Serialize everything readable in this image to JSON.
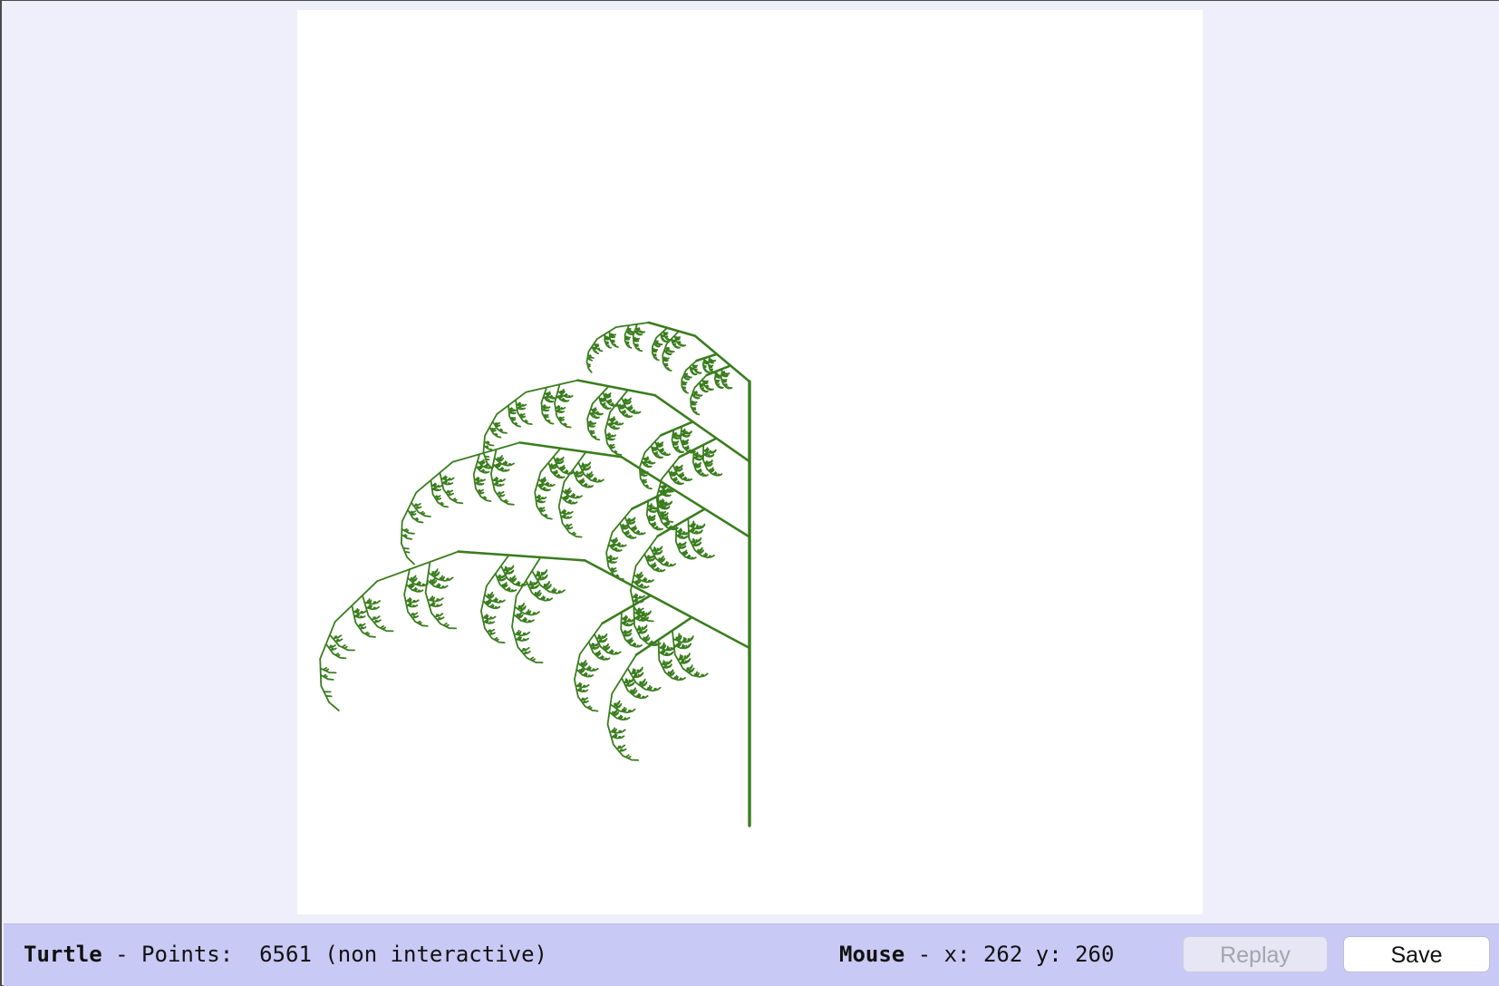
{
  "status": {
    "turtle_label": "Turtle",
    "points_label": " - Points:  ",
    "points_value": "6561",
    "mode": " (non interactive)",
    "mouse_label": "Mouse",
    "mouse_x_label": " - x: ",
    "mouse_x": "262",
    "mouse_y_label": " y: ",
    "mouse_y": "260"
  },
  "buttons": {
    "replay_label": "Replay",
    "save_label": "Save"
  },
  "drawing": {
    "stroke_color": "#3a7d1e",
    "canvas_color": "#ffffff",
    "recursion_depth": 8,
    "branches_per_node": 3
  }
}
